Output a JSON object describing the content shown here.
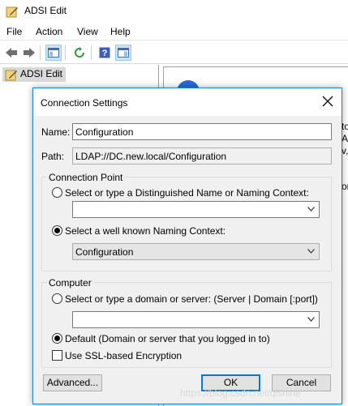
{
  "window": {
    "title": "ADSI Edit",
    "menu": [
      "File",
      "Action",
      "View",
      "Help"
    ]
  },
  "toolbar": {
    "icons": [
      "back-arrow-icon",
      "forward-arrow-icon",
      "console-tree-icon",
      "refresh-icon",
      "help-icon",
      "action-pane-icon"
    ]
  },
  "tree": {
    "root_label": "ADSI Edit"
  },
  "right_pane": {
    "fragments": [
      "to",
      "A",
      "v,",
      "or"
    ]
  },
  "dialog": {
    "title": "Connection Settings",
    "name_label": "Name:",
    "name_value": "Configuration",
    "path_label": "Path:",
    "path_value": "LDAP://DC.new.local/Configuration",
    "connection_point": {
      "group_label": "Connection Point",
      "option_dn_label": "Select or type a Distinguished Name or Naming Context:",
      "option_dn_checked": false,
      "dn_value": "",
      "option_wellknown_label": "Select a well known Naming Context:",
      "option_wellknown_checked": true,
      "wellknown_value": "Configuration"
    },
    "computer": {
      "group_label": "Computer",
      "option_server_label": "Select or type a domain or server: (Server | Domain [:port])",
      "option_server_checked": false,
      "server_value": "",
      "option_default_label": "Default (Domain or server that you logged in to)",
      "option_default_checked": true,
      "ssl_label": "Use SSL-based Encryption",
      "ssl_checked": false
    },
    "buttons": {
      "advanced": "Advanced...",
      "ok": "OK",
      "cancel": "Cancel"
    }
  },
  "watermark": "https://blog.csdn.net/qishine"
}
